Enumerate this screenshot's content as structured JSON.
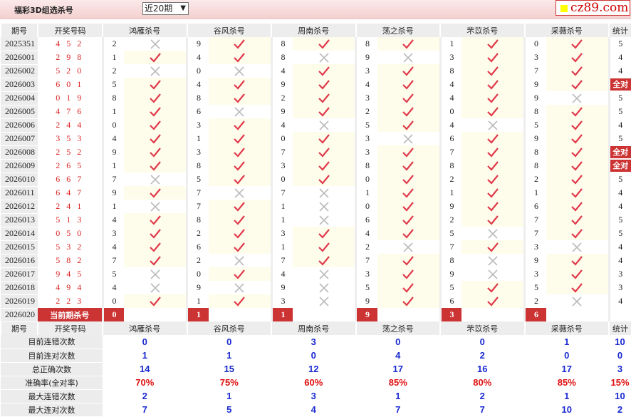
{
  "header": {
    "title": "福彩3D组选杀号",
    "period_select": "近20期",
    "logo": "cz89.com"
  },
  "columns": {
    "period": "期号",
    "draw": "开奖号码",
    "experts": [
      "鸿雁杀号",
      "谷风杀号",
      "周南杀号",
      "荡之杀号",
      "芣苡杀号",
      "采薇杀号"
    ],
    "stat": "统计"
  },
  "rows": [
    {
      "period": "2025351",
      "draw": "4 5 2",
      "kills": [
        2,
        9,
        8,
        8,
        1,
        0
      ],
      "stat": "5"
    },
    {
      "period": "2026001",
      "draw": "2 9 8",
      "kills": [
        1,
        4,
        8,
        9,
        3,
        3
      ],
      "stat": "4"
    },
    {
      "period": "2026002",
      "draw": "5 2 0",
      "kills": [
        2,
        0,
        4,
        3,
        8,
        7
      ],
      "stat": "4"
    },
    {
      "period": "2026003",
      "draw": "6 0 1",
      "kills": [
        5,
        4,
        9,
        4,
        4,
        9
      ],
      "stat": "全对"
    },
    {
      "period": "2026004",
      "draw": "0 1 9",
      "kills": [
        8,
        8,
        2,
        3,
        4,
        9
      ],
      "stat": "5"
    },
    {
      "period": "2026005",
      "draw": "4 7 6",
      "kills": [
        1,
        6,
        9,
        2,
        0,
        8
      ],
      "stat": "5"
    },
    {
      "period": "2026006",
      "draw": "2 4 4",
      "kills": [
        0,
        3,
        4,
        5,
        4,
        5
      ],
      "stat": "4"
    },
    {
      "period": "2026007",
      "draw": "3 5 3",
      "kills": [
        4,
        1,
        0,
        3,
        6,
        9
      ],
      "stat": "5"
    },
    {
      "period": "2026008",
      "draw": "2 5 2",
      "kills": [
        9,
        3,
        7,
        3,
        7,
        8
      ],
      "stat": "全对"
    },
    {
      "period": "2026009",
      "draw": "2 6 5",
      "kills": [
        1,
        8,
        3,
        8,
        8,
        8
      ],
      "stat": "全对"
    },
    {
      "period": "2026010",
      "draw": "6 6 7",
      "kills": [
        7,
        5,
        0,
        0,
        2,
        2
      ],
      "stat": "5"
    },
    {
      "period": "2026011",
      "draw": "6 4 7",
      "kills": [
        9,
        7,
        7,
        1,
        1,
        1
      ],
      "stat": "4"
    },
    {
      "period": "2026012",
      "draw": "2 4 1",
      "kills": [
        1,
        7,
        1,
        0,
        9,
        6
      ],
      "stat": "4"
    },
    {
      "period": "2026013",
      "draw": "5 1 3",
      "kills": [
        4,
        8,
        1,
        6,
        2,
        7
      ],
      "stat": "5"
    },
    {
      "period": "2026014",
      "draw": "0 5 0",
      "kills": [
        3,
        2,
        3,
        4,
        5,
        7
      ],
      "stat": "5"
    },
    {
      "period": "2026015",
      "draw": "5 3 2",
      "kills": [
        4,
        6,
        1,
        2,
        7,
        3
      ],
      "stat": "4"
    },
    {
      "period": "2026016",
      "draw": "5 8 2",
      "kills": [
        7,
        2,
        7,
        7,
        8,
        9
      ],
      "stat": "4"
    },
    {
      "period": "2026017",
      "draw": "9 4 5",
      "kills": [
        5,
        0,
        4,
        3,
        9,
        3
      ],
      "stat": "3"
    },
    {
      "period": "2026018",
      "draw": "4 9 4",
      "kills": [
        4,
        9,
        9,
        5,
        5,
        5
      ],
      "stat": "3"
    },
    {
      "period": "2026019",
      "draw": "2 2 3",
      "kills": [
        0,
        1,
        3,
        9,
        6,
        2
      ],
      "stat": "4"
    }
  ],
  "current": {
    "period": "2026020",
    "label": "当前期杀号",
    "kills": [
      "0",
      "1",
      "1",
      "9",
      "3",
      "6"
    ]
  },
  "stats": [
    {
      "label": "目前连错次数",
      "values": [
        "0",
        "0",
        "3",
        "0",
        "0",
        "1"
      ],
      "total": "10"
    },
    {
      "label": "目前连对次数",
      "values": [
        "1",
        "1",
        "0",
        "4",
        "2",
        "0"
      ],
      "total": "0"
    },
    {
      "label": "总正确次数",
      "values": [
        "14",
        "15",
        "12",
        "17",
        "16",
        "17"
      ],
      "total": "3"
    },
    {
      "label": "准确率(全对率)",
      "values": [
        "70%",
        "75%",
        "60%",
        "85%",
        "80%",
        "85%"
      ],
      "total": "15%",
      "red": true
    },
    {
      "label": "最大连错次数",
      "values": [
        "2",
        "1",
        "3",
        "1",
        "2",
        "1"
      ],
      "total": "10"
    },
    {
      "label": "最大连对次数",
      "values": [
        "7",
        "5",
        "4",
        "7",
        "7",
        "10"
      ],
      "total": "2"
    }
  ],
  "colors": {
    "check": "#e0394a",
    "cross": "#bbbbbb",
    "accent": "#cc3333"
  }
}
